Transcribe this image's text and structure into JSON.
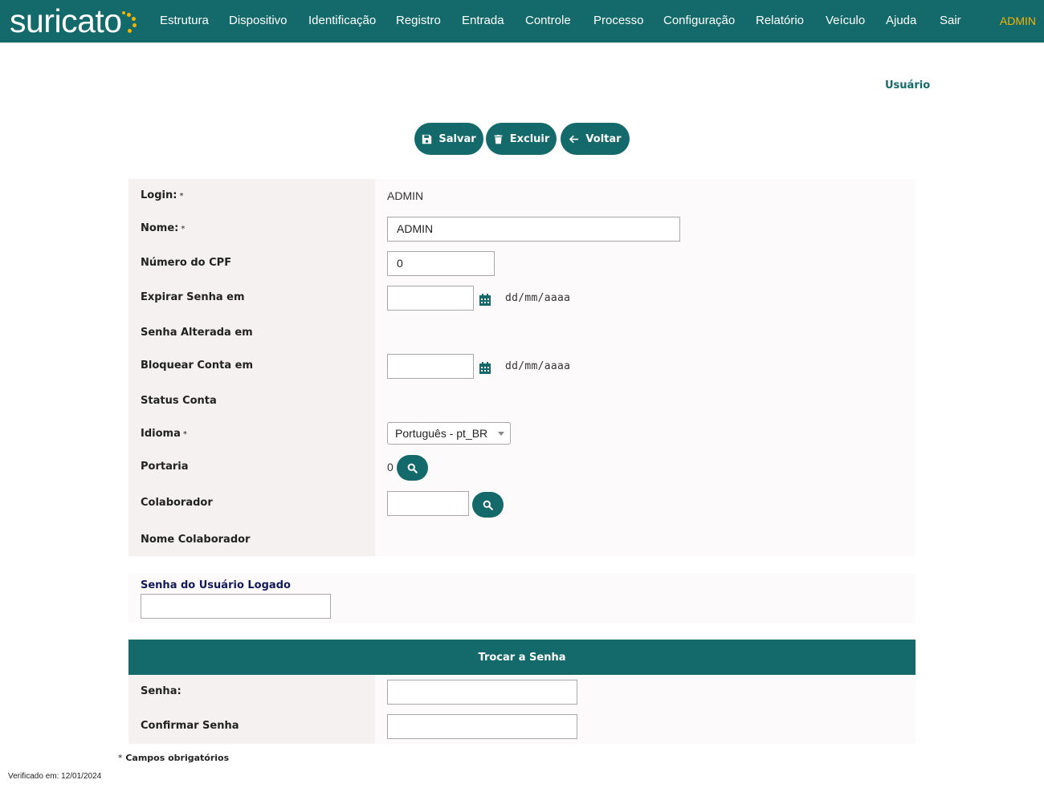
{
  "header": {
    "logo_text": "suricato",
    "nav": [
      {
        "label": "Estrutura"
      },
      {
        "label": "Dispositivo"
      },
      {
        "label": "Identificação"
      },
      {
        "label": "Registro"
      },
      {
        "label": "Entrada"
      },
      {
        "label": "Controle"
      },
      {
        "label": "Processo"
      },
      {
        "label": "Configuração"
      },
      {
        "label": "Relatório"
      },
      {
        "label": "Veículo"
      },
      {
        "label": "Ajuda"
      },
      {
        "label": "Sair"
      }
    ],
    "user": "ADMIN"
  },
  "page": {
    "title": "Usuário"
  },
  "toolbar": {
    "save_label": "Salvar",
    "delete_label": "Excluir",
    "back_label": "Voltar"
  },
  "form": {
    "login": {
      "label": "Login:",
      "required": "*",
      "value": "ADMIN"
    },
    "nome": {
      "label": "Nome:",
      "required": "*",
      "value": "ADMIN"
    },
    "cpf": {
      "label": "Número do CPF",
      "value": "0"
    },
    "expirar_senha": {
      "label": "Expirar Senha em",
      "value": "",
      "hint": "dd/mm/aaaa"
    },
    "senha_alterada": {
      "label": "Senha Alterada em"
    },
    "bloquear_conta": {
      "label": "Bloquear Conta em",
      "value": "",
      "hint": "dd/mm/aaaa"
    },
    "status_conta": {
      "label": "Status Conta"
    },
    "idioma": {
      "label": "Idioma",
      "required": "*",
      "selected": "Português - pt_BR"
    },
    "portaria": {
      "label": "Portaria",
      "value": "0"
    },
    "colaborador": {
      "label": "Colaborador",
      "value": ""
    },
    "nome_colaborador": {
      "label": "Nome Colaborador"
    }
  },
  "logged_password": {
    "label": "Senha do Usuário Logado",
    "value": ""
  },
  "change_password": {
    "title": "Trocar a Senha",
    "senha": {
      "label": "Senha:",
      "value": ""
    },
    "confirmar": {
      "label": "Confirmar Senha",
      "value": ""
    }
  },
  "footer": {
    "required_star": "*",
    "required_note": "Campos obrigatórios",
    "verified": "Verificado em: 12/01/2024"
  },
  "colors": {
    "primary": "#146a6a",
    "accent": "#f5b400",
    "label_bg": "#f4f1f0"
  }
}
